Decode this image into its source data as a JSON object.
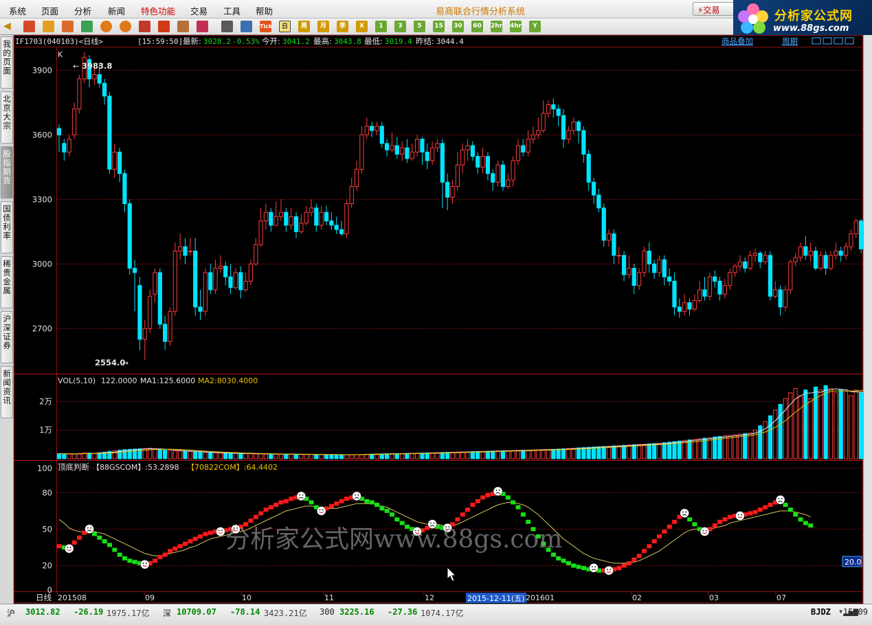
{
  "menu": {
    "items": [
      "系统",
      "页面",
      "分析",
      "新闻",
      "特色功能",
      "交易",
      "工具",
      "帮助"
    ],
    "highlight_index": 4,
    "app_title": "易商联合行情分析系统",
    "trade_button": "⚡交易"
  },
  "logo": {
    "title": "分析家公式网",
    "url": "www.88gs.com"
  },
  "toolbar": {
    "keyed_buttons": [
      "Tick",
      "日",
      "周",
      "月",
      "季",
      "X",
      "1",
      "3",
      "5",
      "15",
      "30",
      "60",
      "2hr",
      "4hr",
      "Y"
    ],
    "selected": "日"
  },
  "sidebar": {
    "tabs": [
      "我的页面",
      "北京大宗",
      "股指期货",
      "国债利率",
      "稀贵金属",
      "沪深证券",
      "新闻资讯"
    ],
    "active_index": 2
  },
  "header": {
    "symbol": "IF1703(040103)<日线>",
    "time": "[15:59:50]",
    "latest_label": "最新:",
    "latest_value": "3028.2",
    "change": "-0.53%",
    "open_label": "今开:",
    "open_value": "3041.2",
    "high_label": "最高:",
    "high_value": "3043.8",
    "low_label": "最低:",
    "low_value": "3019.4",
    "prev_label": "昨结:",
    "prev_value": "3044.4",
    "link_1": "商品叠加",
    "link_2": "周期"
  },
  "price_panel": {
    "label": "K",
    "y_ticks": [
      "3900",
      "3600",
      "3300",
      "3000",
      "2700"
    ],
    "max_annotation": "3983.8",
    "min_annotation": "2554.0"
  },
  "vol_panel": {
    "name": "VOL(5,10)",
    "value": "122.0000",
    "ma1": "MA1:125.6000",
    "ma2": "MA2:8030.4000",
    "y_ticks": [
      "2万",
      "1万"
    ]
  },
  "ind_panel": {
    "name": "顶底判断",
    "series_1": "【88GSCOM】:53.2898",
    "series_2": "【70822COM】:64.4402",
    "y_ticks": [
      "100",
      "80",
      "50",
      "20",
      "0"
    ],
    "right_value": "20.0"
  },
  "watermark": "分析家公式网www.88gs.com",
  "x_axis": {
    "period_label": "日线",
    "labels": [
      "201508",
      "09",
      "10",
      "11",
      "12",
      "201601",
      "02",
      "03",
      "07"
    ],
    "cursor_date": "2015-12-11(五)"
  },
  "statusbar": {
    "sh_label": "沪",
    "sh_value": "3012.82",
    "sh_change": "-26.19",
    "sh_amount": "1975.17亿",
    "sz_label": "深",
    "sz_value": "10709.07",
    "sz_change": "-78.14",
    "sz_amount": "3423.21亿",
    "i300_label": "300",
    "i300_value": "3225.16",
    "i300_change": "-27.36",
    "i300_amount": "1074.17亿",
    "bjdz": "BJDZ",
    "time": "15:09"
  },
  "colors": {
    "up": "#ff3c3c",
    "down": "#00e4ff",
    "grid": "#8a1212",
    "ma1": "#e8e8e8",
    "ma2": "#e6c200",
    "ind_up": "#ff1a1a",
    "ind_down": "#16e016",
    "ind_line": "#d8c860"
  },
  "chart_data": {
    "type": "candlestick",
    "price_ylim": [
      2500,
      4000
    ],
    "candles": [
      [
        3630,
        3600,
        3650,
        3520
      ],
      [
        3560,
        3520,
        3580,
        3480
      ],
      [
        3520,
        3580,
        3600,
        3500
      ],
      [
        3600,
        3720,
        3750,
        3580
      ],
      [
        3720,
        3860,
        3880,
        3700
      ],
      [
        3860,
        3960,
        3983.8,
        3840
      ],
      [
        3950,
        3860,
        3970,
        3820
      ],
      [
        3860,
        3880,
        3920,
        3830
      ],
      [
        3880,
        3840,
        3930,
        3820
      ],
      [
        3840,
        3780,
        3860,
        3740
      ],
      [
        3780,
        3440,
        3800,
        3420
      ],
      [
        3440,
        3520,
        3560,
        3400
      ],
      [
        3520,
        3420,
        3540,
        3380
      ],
      [
        3420,
        3280,
        3440,
        3240
      ],
      [
        3280,
        2980,
        3300,
        2950
      ],
      [
        2980,
        2960,
        3020,
        2780
      ],
      [
        2900,
        2650,
        2940,
        2600
      ],
      [
        2650,
        2700,
        2740,
        2554
      ],
      [
        2700,
        2850,
        2880,
        2680
      ],
      [
        2860,
        2960,
        2980,
        2820
      ],
      [
        2960,
        2720,
        2980,
        2700
      ],
      [
        2720,
        2640,
        2760,
        2600
      ],
      [
        2640,
        2780,
        2800,
        2620
      ],
      [
        2780,
        3060,
        3100,
        2760
      ],
      [
        3060,
        3080,
        3140,
        3020
      ],
      [
        3080,
        3040,
        3120,
        3000
      ],
      [
        3060,
        3060,
        3120,
        3040
      ],
      [
        3060,
        2800,
        3120,
        2760
      ],
      [
        2800,
        2780,
        2880,
        2740
      ],
      [
        2780,
        2960,
        2980,
        2760
      ],
      [
        2960,
        2880,
        3000,
        2860
      ],
      [
        2880,
        2980,
        3020,
        2860
      ],
      [
        2980,
        2990,
        3040,
        2960
      ],
      [
        2990,
        2940,
        3010,
        2900
      ],
      [
        2940,
        2890,
        3000,
        2860
      ],
      [
        2890,
        2960,
        2980,
        2880
      ],
      [
        2960,
        2880,
        2990,
        2840
      ],
      [
        2880,
        2920,
        2960,
        2870
      ],
      [
        2920,
        3000,
        3020,
        2900
      ],
      [
        3000,
        3090,
        3120,
        2990
      ],
      [
        3090,
        3200,
        3260,
        3080
      ],
      [
        3200,
        3240,
        3280,
        3160
      ],
      [
        3240,
        3180,
        3260,
        3150
      ],
      [
        3180,
        3220,
        3290,
        3180
      ],
      [
        3220,
        3240,
        3300,
        3200
      ],
      [
        3240,
        3180,
        3260,
        3150
      ],
      [
        3180,
        3220,
        3260,
        3160
      ],
      [
        3220,
        3150,
        3240,
        3120
      ],
      [
        3150,
        3190,
        3230,
        3140
      ],
      [
        3190,
        3240,
        3270,
        3180
      ],
      [
        3240,
        3260,
        3300,
        3220
      ],
      [
        3260,
        3180,
        3280,
        3150
      ],
      [
        3180,
        3240,
        3270,
        3160
      ],
      [
        3240,
        3200,
        3270,
        3180
      ],
      [
        3200,
        3180,
        3240,
        3160
      ],
      [
        3180,
        3160,
        3220,
        3140
      ],
      [
        3160,
        3140,
        3200,
        3130
      ],
      [
        3140,
        3280,
        3300,
        3120
      ],
      [
        3280,
        3360,
        3400,
        3260
      ],
      [
        3360,
        3440,
        3480,
        3340
      ],
      [
        3440,
        3600,
        3640,
        3420
      ],
      [
        3600,
        3640,
        3680,
        3580
      ],
      [
        3640,
        3620,
        3660,
        3590
      ],
      [
        3620,
        3640,
        3660,
        3600
      ],
      [
        3640,
        3560,
        3660,
        3540
      ],
      [
        3560,
        3530,
        3580,
        3500
      ],
      [
        3530,
        3550,
        3610,
        3520
      ],
      [
        3550,
        3510,
        3590,
        3490
      ],
      [
        3510,
        3540,
        3570,
        3480
      ],
      [
        3540,
        3490,
        3580,
        3470
      ],
      [
        3490,
        3520,
        3560,
        3480
      ],
      [
        3520,
        3580,
        3600,
        3500
      ],
      [
        3580,
        3520,
        3590,
        3460
      ],
      [
        3520,
        3480,
        3560,
        3440
      ],
      [
        3480,
        3540,
        3570,
        3460
      ],
      [
        3540,
        3560,
        3580,
        3520
      ],
      [
        3560,
        3380,
        3580,
        3260
      ],
      [
        3380,
        3310,
        3420,
        3250
      ],
      [
        3310,
        3360,
        3390,
        3280
      ],
      [
        3360,
        3460,
        3520,
        3340
      ],
      [
        3460,
        3530,
        3560,
        3420
      ],
      [
        3530,
        3550,
        3580,
        3480
      ],
      [
        3550,
        3500,
        3570,
        3480
      ],
      [
        3500,
        3450,
        3520,
        3420
      ],
      [
        3450,
        3500,
        3540,
        3420
      ],
      [
        3500,
        3420,
        3520,
        3390
      ],
      [
        3420,
        3380,
        3440,
        3340
      ],
      [
        3380,
        3460,
        3480,
        3360
      ],
      [
        3460,
        3360,
        3480,
        3340
      ],
      [
        3360,
        3390,
        3420,
        3350
      ],
      [
        3390,
        3480,
        3500,
        3360
      ],
      [
        3480,
        3550,
        3580,
        3460
      ],
      [
        3550,
        3520,
        3580,
        3500
      ],
      [
        3520,
        3580,
        3620,
        3500
      ],
      [
        3580,
        3600,
        3640,
        3560
      ],
      [
        3600,
        3620,
        3680,
        3580
      ],
      [
        3620,
        3700,
        3760,
        3610
      ],
      [
        3700,
        3740,
        3760,
        3680
      ],
      [
        3740,
        3720,
        3770,
        3680
      ],
      [
        3720,
        3690,
        3740,
        3640
      ],
      [
        3690,
        3580,
        3720,
        3540
      ],
      [
        3580,
        3620,
        3640,
        3560
      ],
      [
        3620,
        3660,
        3680,
        3600
      ],
      [
        3660,
        3620,
        3670,
        3560
      ],
      [
        3620,
        3510,
        3640,
        3470
      ],
      [
        3510,
        3380,
        3530,
        3340
      ],
      [
        3380,
        3320,
        3400,
        3280
      ],
      [
        3320,
        3260,
        3350,
        3240
      ],
      [
        3260,
        3110,
        3280,
        3080
      ],
      [
        3110,
        3140,
        3160,
        3080
      ],
      [
        3140,
        3040,
        3160,
        3000
      ],
      [
        3040,
        3040,
        3080,
        3000
      ],
      [
        3040,
        2950,
        3060,
        2920
      ],
      [
        2950,
        2980,
        3040,
        2930
      ],
      [
        2980,
        2900,
        3000,
        2860
      ],
      [
        2900,
        2960,
        2980,
        2880
      ],
      [
        2960,
        3060,
        3080,
        2940
      ],
      [
        3060,
        3000,
        3100,
        2960
      ],
      [
        3000,
        2960,
        3020,
        2930
      ],
      [
        2960,
        3020,
        3040,
        2940
      ],
      [
        3020,
        2940,
        3040,
        2900
      ],
      [
        2940,
        2920,
        2980,
        2900
      ],
      [
        2920,
        2800,
        2960,
        2760
      ],
      [
        2800,
        2780,
        2840,
        2750
      ],
      [
        2780,
        2820,
        2860,
        2760
      ],
      [
        2820,
        2790,
        2840,
        2760
      ],
      [
        2790,
        2830,
        2860,
        2780
      ],
      [
        2830,
        2880,
        2920,
        2820
      ],
      [
        2880,
        2850,
        2940,
        2830
      ],
      [
        2850,
        2940,
        2960,
        2830
      ],
      [
        2940,
        2920,
        2970,
        2890
      ],
      [
        2920,
        2860,
        2940,
        2830
      ],
      [
        2860,
        2900,
        2930,
        2840
      ],
      [
        2900,
        2960,
        2980,
        2880
      ],
      [
        2960,
        2990,
        3000,
        2940
      ],
      [
        2990,
        3010,
        3040,
        2970
      ],
      [
        3010,
        2980,
        3030,
        2960
      ],
      [
        2980,
        3040,
        3060,
        2970
      ],
      [
        3040,
        3050,
        3070,
        3010
      ],
      [
        3050,
        3010,
        3060,
        2980
      ],
      [
        3010,
        3040,
        3060,
        3000
      ],
      [
        3040,
        2850,
        3060,
        2830
      ],
      [
        2850,
        2880,
        2920,
        2840
      ],
      [
        2880,
        2800,
        2900,
        2760
      ],
      [
        2800,
        2880,
        2900,
        2780
      ],
      [
        2880,
        3010,
        3020,
        2860
      ],
      [
        3010,
        3030,
        3050,
        2990
      ],
      [
        3030,
        3080,
        3100,
        3010
      ],
      [
        3080,
        3040,
        3130,
        3020
      ],
      [
        3040,
        3060,
        3100,
        3010
      ],
      [
        3060,
        2980,
        3080,
        2970
      ],
      [
        2980,
        3040,
        3060,
        2970
      ],
      [
        3040,
        2980,
        3060,
        2950
      ],
      [
        2980,
        3040,
        3060,
        2970
      ],
      [
        3040,
        3060,
        3100,
        3020
      ],
      [
        3060,
        3040,
        3080,
        3010
      ],
      [
        3040,
        3080,
        3100,
        3020
      ],
      [
        3080,
        3140,
        3160,
        3060
      ],
      [
        3140,
        3200,
        3210,
        3120
      ],
      [
        3200,
        3070,
        3210,
        3050
      ],
      [
        3070,
        3050,
        3080,
        3020
      ],
      [
        3050,
        3030,
        3060,
        3010
      ],
      [
        3030,
        3050,
        3070,
        3020
      ],
      [
        3050,
        3028,
        3060,
        3019
      ]
    ],
    "volume": [
      1800,
      1700,
      1650,
      1600,
      1900,
      2100,
      2000,
      1900,
      2100,
      2300,
      2600,
      2800,
      3000,
      3200,
      3300,
      3400,
      3500,
      3600,
      3700,
      3400,
      3200,
      3000,
      2900,
      2800,
      2700,
      2600,
      2500,
      2400,
      2300,
      2200,
      2100,
      2050,
      2000,
      1950,
      1900,
      1850,
      1800,
      1800,
      1750,
      1700,
      1700,
      1650,
      1650,
      1600,
      1600,
      1600,
      1550,
      1550,
      1500,
      1500,
      1500,
      1450,
      1450,
      1450,
      1400,
      1400,
      1400,
      1400,
      1450,
      1500,
      1550,
      1600,
      1650,
      1700,
      1700,
      1750,
      1800,
      1800,
      1850,
      1900,
      1900,
      1950,
      2000,
      2050,
      2100,
      2150,
      2200,
      2250,
      2300,
      2350,
      2400,
      2450,
      2500,
      2550,
      2600,
      2650,
      2700,
      2750,
      2800,
      2850,
      2900,
      2950,
      3000,
      3050,
      3100,
      3150,
      3200,
      3250,
      3300,
      3400,
      3500,
      3600,
      3700,
      3800,
      3900,
      4000,
      4100,
      4200,
      4300,
      4400,
      4500,
      4600,
      4700,
      4800,
      4900,
      5000,
      5100,
      5200,
      5300,
      5400,
      5600,
      5800,
      6000,
      6200,
      6400,
      6600,
      6800,
      7000,
      7200,
      7400,
      7600,
      7800,
      8000,
      8200,
      8400,
      8600,
      8800,
      9000,
      10000,
      11500,
      13000,
      15000,
      17000,
      19000,
      21000,
      23000,
      24500,
      22000,
      24000,
      21000,
      25000,
      24000,
      25500,
      24500,
      23000,
      24000,
      23500,
      22000,
      24000,
      23000,
      22500,
      21500,
      20000,
      18000,
      13000,
      7000,
      3000,
      122
    ],
    "indicator_88gscom": [
      36,
      35,
      34,
      39,
      43,
      47,
      49,
      46,
      43,
      40,
      37,
      33,
      29,
      26,
      24,
      23,
      22,
      21,
      22,
      24,
      27,
      29,
      32,
      34,
      36,
      38,
      40,
      42,
      44,
      46,
      47,
      48,
      48,
      49,
      50,
      50,
      52,
      54,
      57,
      60,
      63,
      66,
      68,
      70,
      72,
      73,
      75,
      76,
      76,
      75,
      72,
      68,
      65,
      67,
      69,
      71,
      73,
      75,
      76,
      76,
      75,
      73,
      72,
      70,
      67,
      65,
      62,
      58,
      55,
      52,
      50,
      48,
      49,
      51,
      53,
      52,
      51,
      51,
      54,
      58,
      62,
      66,
      70,
      73,
      76,
      78,
      79,
      80,
      79,
      76,
      72,
      68,
      62,
      56,
      50,
      44,
      38,
      33,
      29,
      26,
      24,
      22,
      20,
      19,
      18,
      17,
      17,
      16,
      16,
      16,
      17,
      18,
      20,
      22,
      25,
      28,
      32,
      36,
      40,
      44,
      48,
      52,
      56,
      60,
      62,
      58,
      54,
      50,
      48,
      50,
      53,
      56,
      58,
      60,
      61,
      61,
      62,
      63,
      64,
      66,
      68,
      70,
      72,
      73,
      70,
      66,
      62,
      58,
      55,
      53
    ],
    "indicator_70822com": [
      58,
      55,
      51,
      49,
      48,
      48,
      49,
      48,
      47,
      46,
      44,
      42,
      40,
      38,
      36,
      34,
      32,
      30,
      29,
      28,
      28,
      29,
      30,
      31,
      32,
      33,
      35,
      36,
      38,
      40,
      42,
      43,
      44,
      45,
      46,
      47,
      48,
      49,
      51,
      53,
      55,
      57,
      59,
      61,
      63,
      65,
      66,
      67,
      68,
      69,
      69,
      68,
      67,
      67,
      67,
      67,
      68,
      69,
      70,
      71,
      71,
      71,
      71,
      70,
      69,
      68,
      66,
      64,
      62,
      60,
      58,
      56,
      55,
      54,
      54,
      54,
      53,
      53,
      53,
      54,
      56,
      58,
      60,
      62,
      64,
      66,
      68,
      70,
      71,
      72,
      72,
      71,
      70,
      68,
      65,
      62,
      58,
      54,
      50,
      46,
      42,
      39,
      36,
      33,
      30,
      28,
      26,
      25,
      24,
      23,
      22,
      22,
      22,
      22,
      23,
      24,
      26,
      28,
      30,
      32,
      35,
      38,
      41,
      44,
      47,
      49,
      50,
      50,
      50,
      50,
      51,
      52,
      53,
      55,
      56,
      57,
      58,
      59,
      60,
      61,
      62,
      63,
      64,
      65,
      65,
      65,
      64,
      63,
      62,
      60
    ]
  }
}
